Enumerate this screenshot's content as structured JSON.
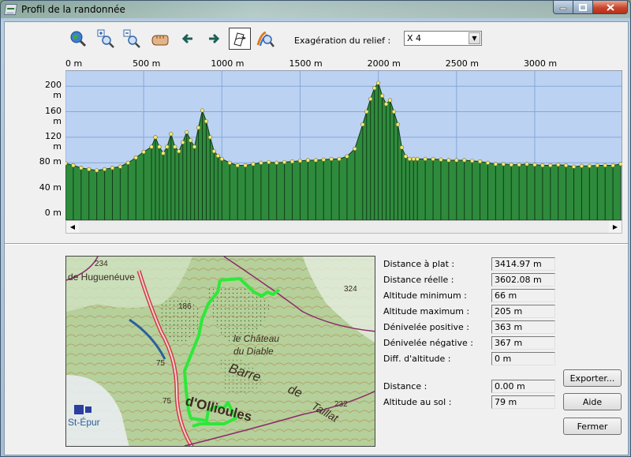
{
  "window": {
    "title": "Profil de la randonnée"
  },
  "toolbar": {
    "tools": [
      {
        "name": "view-all-icon",
        "hint": "globe"
      },
      {
        "name": "zoom-in-icon",
        "hint": "magnifier-plus"
      },
      {
        "name": "zoom-out-icon",
        "hint": "magnifier-minus"
      },
      {
        "name": "pan-hand-icon",
        "hint": "hand"
      },
      {
        "name": "arrow-left-icon",
        "hint": "arrow-left"
      },
      {
        "name": "arrow-right-icon",
        "hint": "arrow-right"
      },
      {
        "name": "map-pointer-icon",
        "hint": "map-cursor",
        "active": true
      },
      {
        "name": "route-search-icon",
        "hint": "route-magnifier"
      }
    ],
    "exaggeration_label": "Exagération du relief :",
    "exaggeration_value": "X 4"
  },
  "chart_data": {
    "type": "area",
    "xlabel": "",
    "ylabel": "",
    "x_ticks": [
      "0 m",
      "500 m",
      "1000 m",
      "1500 m",
      "2000 m",
      "2500 m",
      "3000 m"
    ],
    "y_ticks": [
      "0 m",
      "40 m",
      "80 m",
      "120 m",
      "160 m",
      "200 m"
    ],
    "xlim": [
      0,
      3560
    ],
    "ylim": [
      -10,
      225
    ],
    "grid": true,
    "colors": {
      "fill": "#2e8b3c",
      "background": "#bcd2f3",
      "point": "#f2e978",
      "grid": "#86a7d8"
    },
    "x": [
      0,
      50,
      100,
      150,
      200,
      250,
      300,
      350,
      400,
      450,
      500,
      550,
      575,
      600,
      625,
      650,
      675,
      700,
      725,
      750,
      775,
      800,
      825,
      850,
      875,
      900,
      925,
      950,
      975,
      1000,
      1050,
      1100,
      1150,
      1200,
      1250,
      1300,
      1350,
      1400,
      1450,
      1500,
      1550,
      1600,
      1650,
      1700,
      1750,
      1800,
      1850,
      1900,
      1925,
      1950,
      1975,
      2000,
      2025,
      2050,
      2075,
      2100,
      2125,
      2150,
      2175,
      2200,
      2225,
      2250,
      2300,
      2350,
      2400,
      2450,
      2500,
      2550,
      2600,
      2650,
      2700,
      2750,
      2800,
      2850,
      2900,
      2950,
      3000,
      3050,
      3100,
      3150,
      3200,
      3250,
      3300,
      3350,
      3400,
      3450,
      3500,
      3550
    ],
    "values": [
      79,
      76,
      72,
      70,
      68,
      70,
      72,
      74,
      80,
      88,
      97,
      105,
      120,
      105,
      95,
      105,
      125,
      105,
      98,
      112,
      128,
      115,
      105,
      135,
      162,
      145,
      120,
      98,
      91,
      86,
      80,
      76,
      76,
      78,
      80,
      81,
      80,
      81,
      82,
      83,
      84,
      84,
      85,
      86,
      86,
      90,
      102,
      140,
      160,
      180,
      197,
      205,
      185,
      172,
      178,
      160,
      140,
      104,
      90,
      86,
      86,
      86,
      86,
      86,
      85,
      84,
      84,
      84,
      83,
      82,
      80,
      78,
      78,
      77,
      77,
      78,
      77,
      76,
      76,
      77,
      76,
      74,
      75,
      75,
      76,
      76,
      76,
      78
    ]
  },
  "map": {
    "labels": [
      "de Huguenéuve",
      "234",
      "186",
      "324",
      "le Château",
      "du Diable",
      "Barre",
      "de",
      "75",
      "75",
      "d'Ollioules",
      "Taillat",
      "232",
      "St-Épur"
    ]
  },
  "stats": {
    "rows": [
      {
        "label": "Distance à plat :",
        "value": "3414.97 m"
      },
      {
        "label": "Distance réelle :",
        "value": "3602.08 m"
      },
      {
        "label": "Altitude minimum :",
        "value": "66 m"
      },
      {
        "label": "Altitude maximum :",
        "value": "205 m"
      },
      {
        "label": "Dénivelée positive :",
        "value": "363 m"
      },
      {
        "label": "Dénivelée négative :",
        "value": "367 m"
      },
      {
        "label": "Diff. d'altitude :",
        "value": "0 m"
      }
    ],
    "cursor_rows": [
      {
        "label": "Distance :",
        "value": "0.00 m"
      },
      {
        "label": "Altitude au sol :",
        "value": "79 m"
      }
    ]
  },
  "buttons": {
    "export": "Exporter...",
    "help": "Aide",
    "close": "Fermer"
  }
}
